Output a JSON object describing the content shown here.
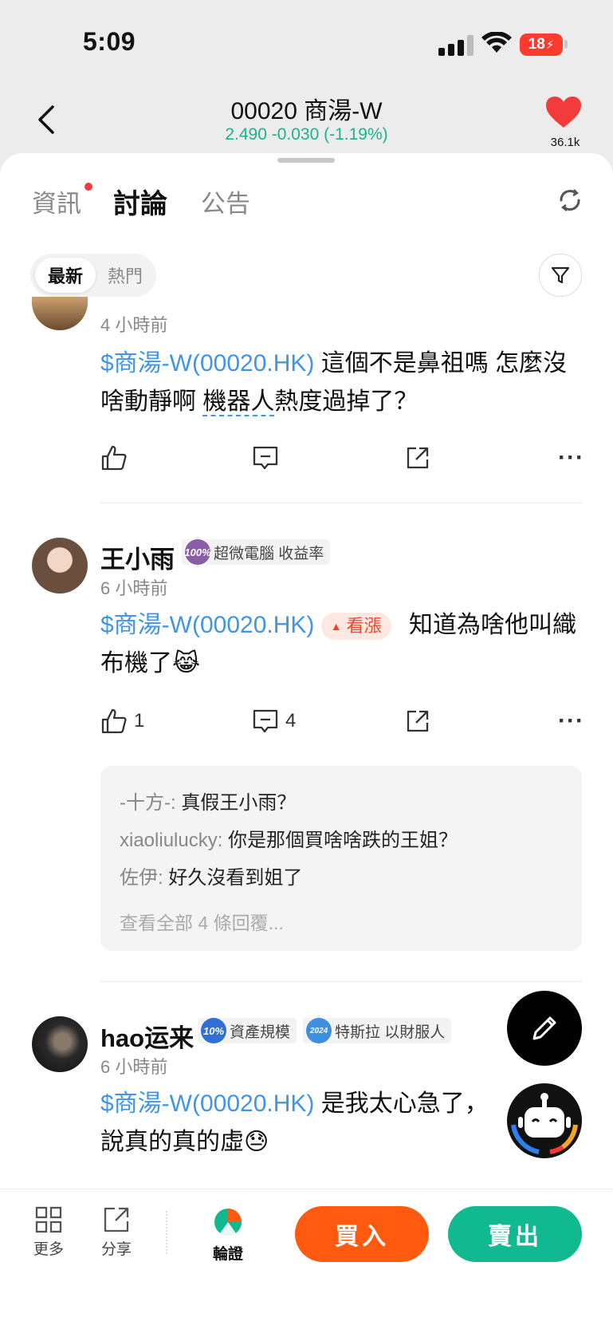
{
  "status_bar": {
    "time": "5:09",
    "battery": "18"
  },
  "header": {
    "title": "00020 商湯-W",
    "price_line": "2.490 -0.030 (-1.19%)",
    "favorite_count": "36.1k"
  },
  "tabs": [
    {
      "label": "資訊"
    },
    {
      "label": "討論"
    },
    {
      "label": "公告"
    }
  ],
  "sort": {
    "latest": "最新",
    "hot": "熱門"
  },
  "posts": [
    {
      "time": "4 小時前",
      "tag": "$商湯-W(00020.HK)",
      "text": " 這個不是鼻祖嗎 怎麼沒啥動靜啊 ",
      "link_word": "機器人",
      "text_after": "熱度過掉了？"
    },
    {
      "user": "王小雨",
      "medal": "100%",
      "badge": "超微電腦 收益率",
      "time": "6 小時前",
      "tag": "$商湯-W(00020.HK)",
      "sentiment": "看漲",
      "text": "知道為啥他叫織布機了😹",
      "likes": "1",
      "comments": "4",
      "replies": [
        {
          "user": "-十方-:",
          "text": " 真假王小雨？"
        },
        {
          "user": "xiaoliulucky:",
          "text": " 你是那個買啥啥跌的王姐？"
        },
        {
          "user": "佐伊:",
          "text": " 好久沒看到姐了"
        }
      ],
      "view_all": "查看全部 4 條回覆..."
    },
    {
      "user": "hao运来",
      "medal": "10%",
      "badge1": "資產規模",
      "medal2": "2024",
      "badge2": "特斯拉 以財服人",
      "time": "6 小時前",
      "tag": "$商湯-W(00020.HK)",
      "text": " 是我太心急了，說真的真的虛😓"
    }
  ],
  "bottom_bar": {
    "more": "更多",
    "share": "分享",
    "warrants": "輪證",
    "buy": "買入",
    "sell": "賣出"
  },
  "colors": {
    "up_green": "#1fb28a",
    "tag_blue": "#3f95ea",
    "buy_orange": "#ff5a0f",
    "sell_green": "#10b98f"
  }
}
